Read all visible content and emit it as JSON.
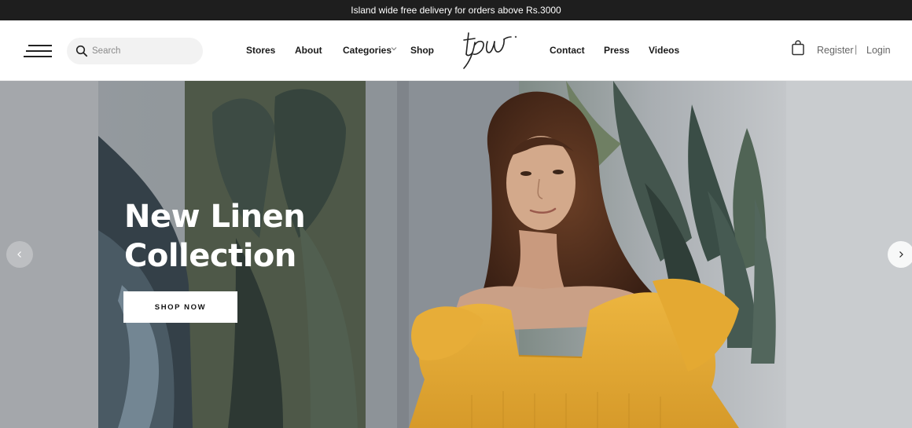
{
  "announcement": {
    "text": "Island wide free delivery for orders above Rs.3000"
  },
  "search": {
    "placeholder": "Search",
    "value": ""
  },
  "nav": {
    "stores": "Stores",
    "about": "About",
    "categories": "Categories",
    "shop": "Shop",
    "contact": "Contact",
    "press": "Press",
    "videos": "Videos"
  },
  "logo": {
    "text": "tpw"
  },
  "account": {
    "register": "Register",
    "separator": "|",
    "login": "Login"
  },
  "icons": {
    "menu": "hamburger-menu-icon",
    "search": "search-icon",
    "categories_dropdown": "chevron-down-icon",
    "bag": "shopping-bag-icon",
    "prev": "chevron-left-icon",
    "next": "chevron-right-icon"
  },
  "hero": {
    "title_line1": "New Linen",
    "title_line2": "Collection",
    "cta": "SHOP NOW"
  },
  "colors": {
    "announcement_bg": "#1e1e1e",
    "dress_yellow": "#e1a532",
    "hero_gray": "#8f959c"
  }
}
